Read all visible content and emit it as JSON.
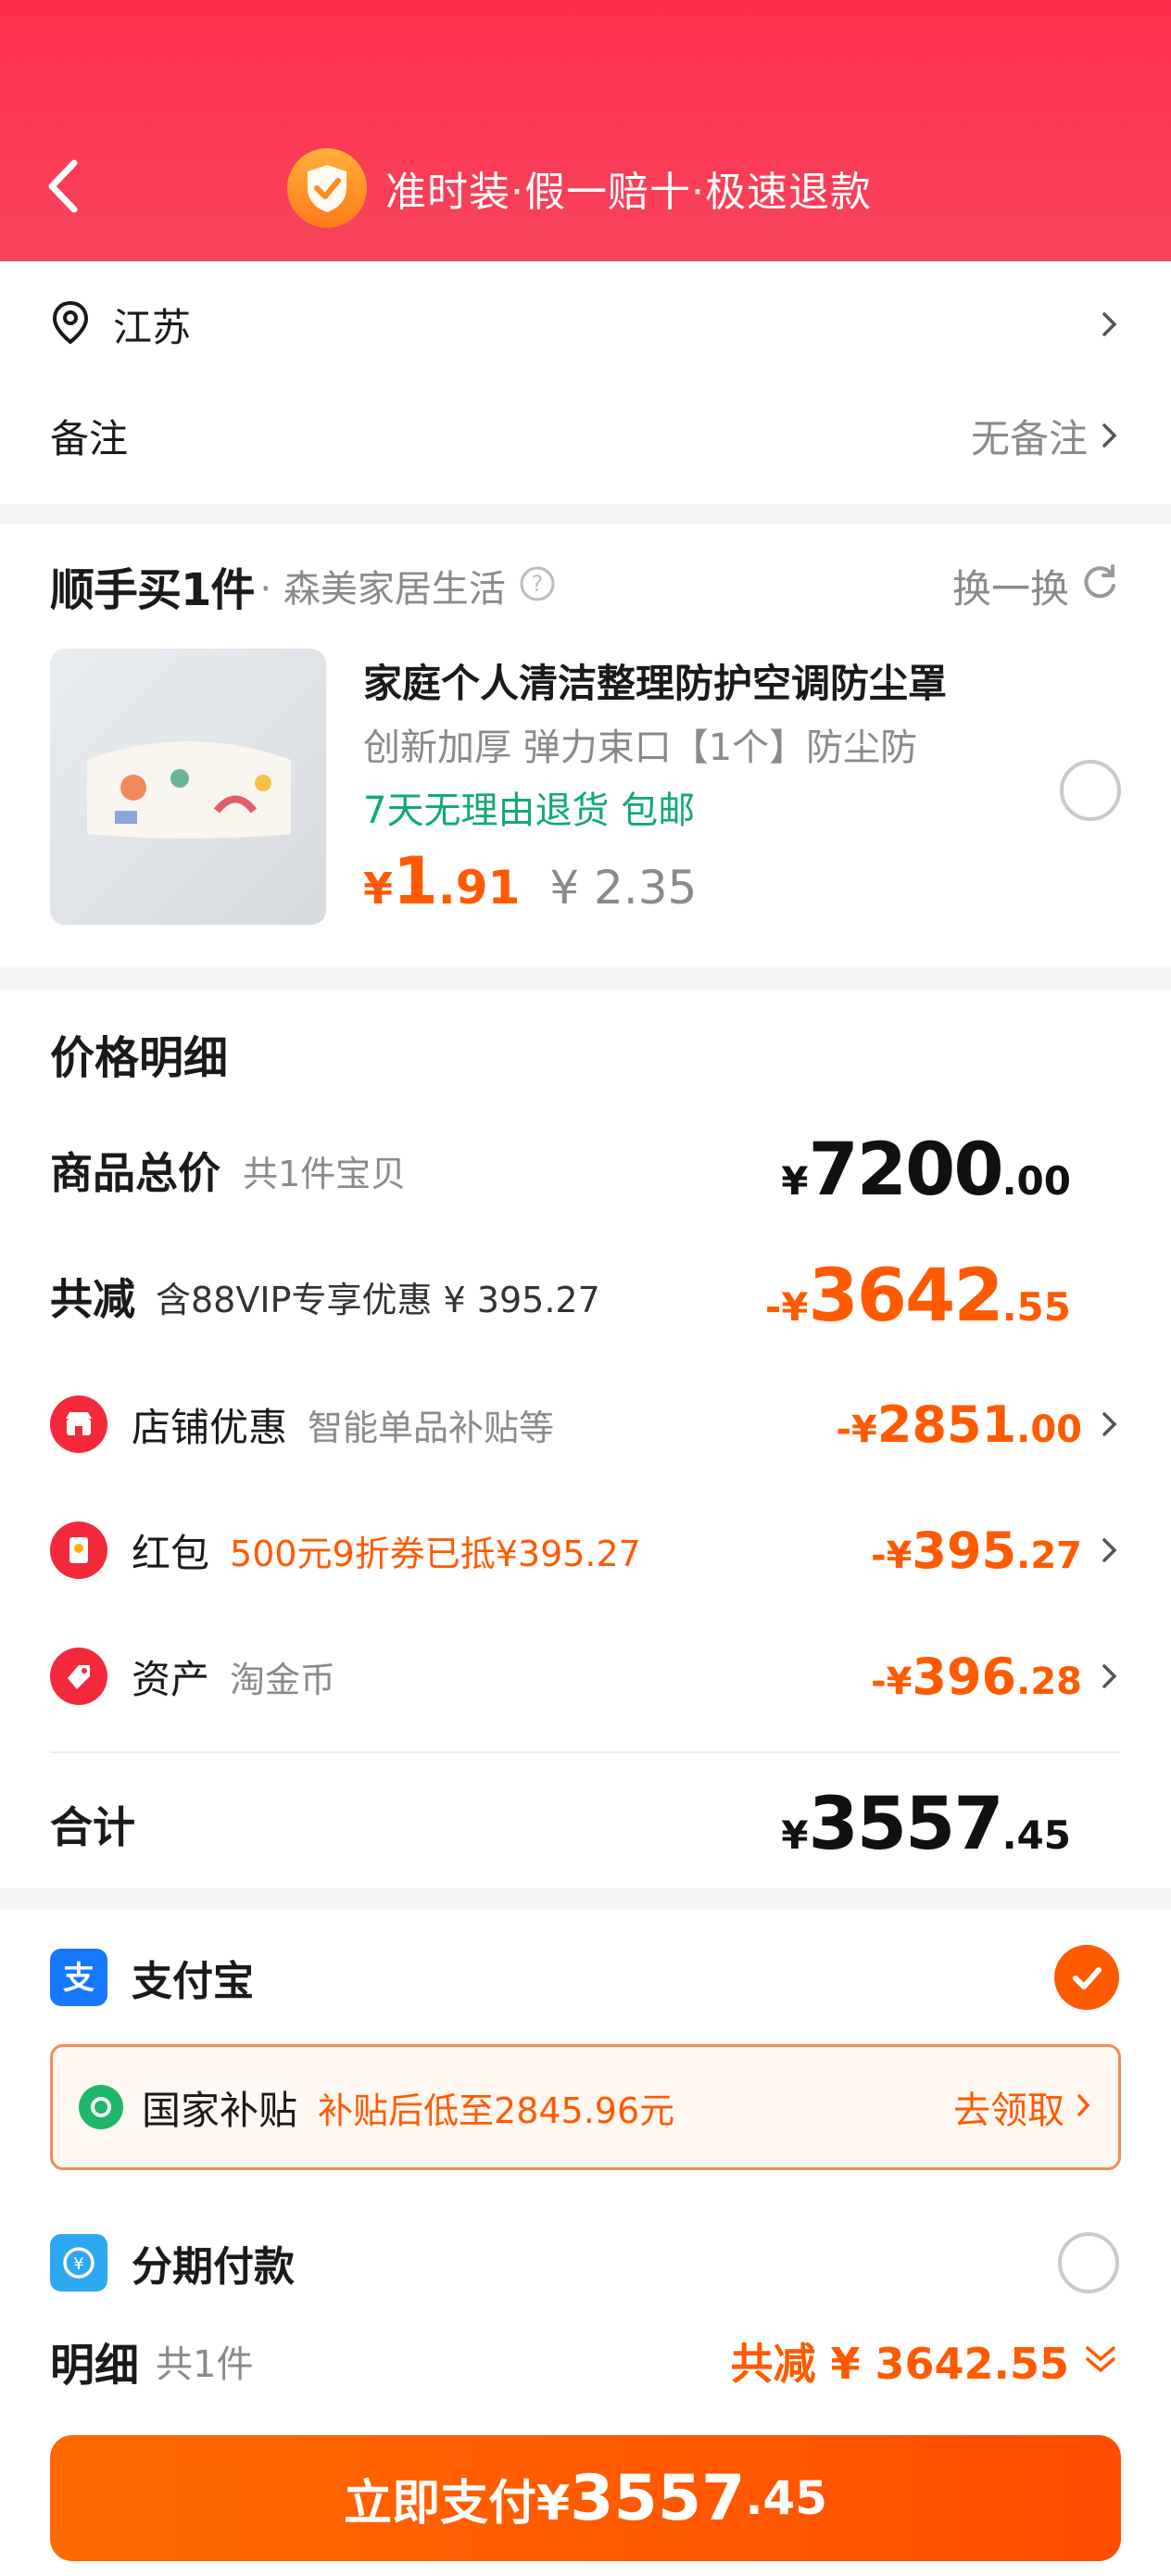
{
  "header": {
    "banner_text": "准时装·假一赔十·极速退款"
  },
  "address": {
    "region": "江苏"
  },
  "remark": {
    "label": "备注",
    "value": "无备注"
  },
  "recommend": {
    "logo_text": "顺手买1件",
    "shop": "· 森美家居生活",
    "switch_label": "换一换",
    "product": {
      "title": "家庭个人清洁整理防护空调防尘罩",
      "subtitle": "创新加厚 弹力束口【1个】防尘防",
      "tags": "7天无理由退货 包邮",
      "price_symbol": "¥",
      "price_int": "1",
      "price_dec": ".91",
      "original_price": "¥ 2.35"
    }
  },
  "price_detail": {
    "title": "价格明细",
    "total_label": "商品总价",
    "total_sub": "共1件宝贝",
    "total_sym": "¥",
    "total_int": "7200",
    "total_dec": ".00",
    "discount_label": "共减",
    "discount_sub": "含88VIP专享优惠 ¥ 395.27",
    "discount_sym": "-¥",
    "discount_int": "3642",
    "discount_dec": ".55",
    "items": [
      {
        "label": "店铺优惠",
        "sub": "智能单品补贴等",
        "sym": "-¥",
        "int": "2851",
        "dec": ".00"
      },
      {
        "label": "红包",
        "sub": "500元9折券已抵¥395.27",
        "sym": "-¥",
        "int": "395",
        "dec": ".27"
      },
      {
        "label": "资产",
        "sub": "淘金币",
        "sym": "-¥",
        "int": "396",
        "dec": ".28"
      }
    ],
    "sum_label": "合计",
    "sum_sym": "¥",
    "sum_int": "3557",
    "sum_dec": ".45"
  },
  "payment": {
    "alipay_label": "支付宝",
    "subsidy_label": "国家补贴",
    "subsidy_text": "补贴后低至2845.96元",
    "subsidy_action": "去领取",
    "installment_label": "分期付款",
    "detail_label": "明细",
    "detail_sub": "共1件",
    "detail_discount": "共减 ¥ 3642.55",
    "pay_button_prefix": "立即支付¥",
    "pay_button_int": "3557",
    "pay_button_dec": ".45"
  },
  "colors": {
    "header_red": "#ff2e4d",
    "accent_orange": "#ff5a00",
    "green_tag": "#12a87a"
  }
}
